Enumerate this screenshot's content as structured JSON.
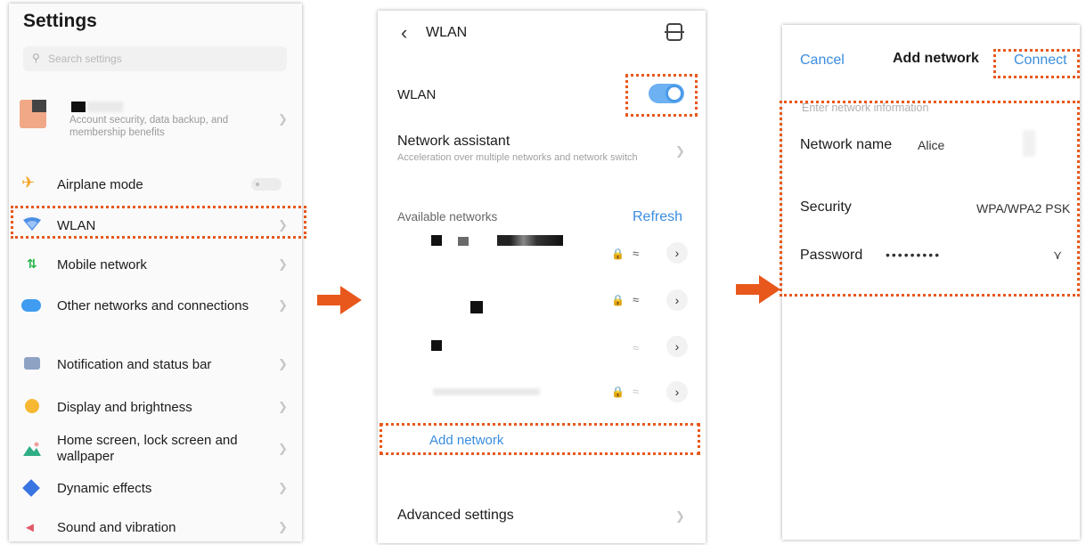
{
  "settings": {
    "title": "Settings",
    "search_placeholder": "Search settings",
    "account_subtitle": "Account security, data backup, and membership benefits",
    "items": [
      {
        "label": "Airplane mode"
      },
      {
        "label": "WLAN"
      },
      {
        "label": "Mobile network"
      },
      {
        "label": "Other networks and connections"
      },
      {
        "label": "Notification and status bar"
      },
      {
        "label": "Display and brightness"
      },
      {
        "label": "Home screen, lock screen and wallpaper"
      },
      {
        "label": "Dynamic effects"
      },
      {
        "label": "Sound and vibration"
      }
    ]
  },
  "wlan": {
    "title": "WLAN",
    "toggle_label": "WLAN",
    "toggle_on": true,
    "assistant_label": "Network assistant",
    "assistant_sub": "Acceleration over multiple networks and network switch",
    "available_label": "Available networks",
    "refresh_label": "Refresh",
    "add_network_label": "Add network",
    "advanced_label": "Advanced settings"
  },
  "add_network": {
    "cancel_label": "Cancel",
    "title": "Add network",
    "connect_label": "Connect",
    "hint": "Enter network information",
    "name_label": "Network name",
    "name_value": "Alice",
    "security_label": "Security",
    "security_value": "WPA/WPA2 PSK",
    "password_label": "Password",
    "password_value": "•••••••••"
  },
  "colors": {
    "accent": "#3a8de0",
    "highlight": "#e8581c"
  }
}
